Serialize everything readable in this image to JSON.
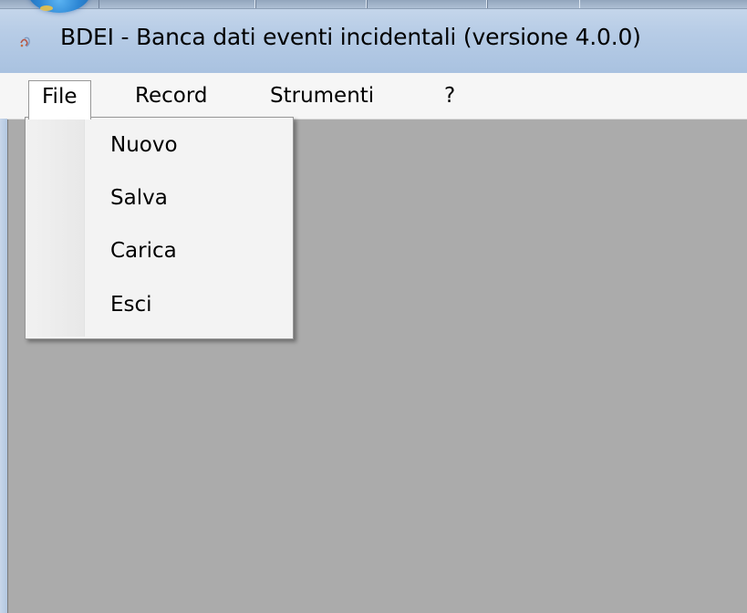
{
  "window": {
    "title": "BDEI - Banca dati eventi incidentali (versione 4.0.0)"
  },
  "menubar": {
    "items": [
      {
        "label": "File"
      },
      {
        "label": "Record"
      },
      {
        "label": "Strumenti"
      },
      {
        "label": "?"
      }
    ]
  },
  "file_menu": {
    "items": [
      {
        "label": "Nuovo"
      },
      {
        "label": "Salva"
      },
      {
        "label": "Carica"
      },
      {
        "label": "Esci"
      }
    ]
  },
  "colors": {
    "client_background": "#ababab",
    "menubar_background": "#f6f6f6",
    "titlebar_accent": "#b7cce6"
  }
}
